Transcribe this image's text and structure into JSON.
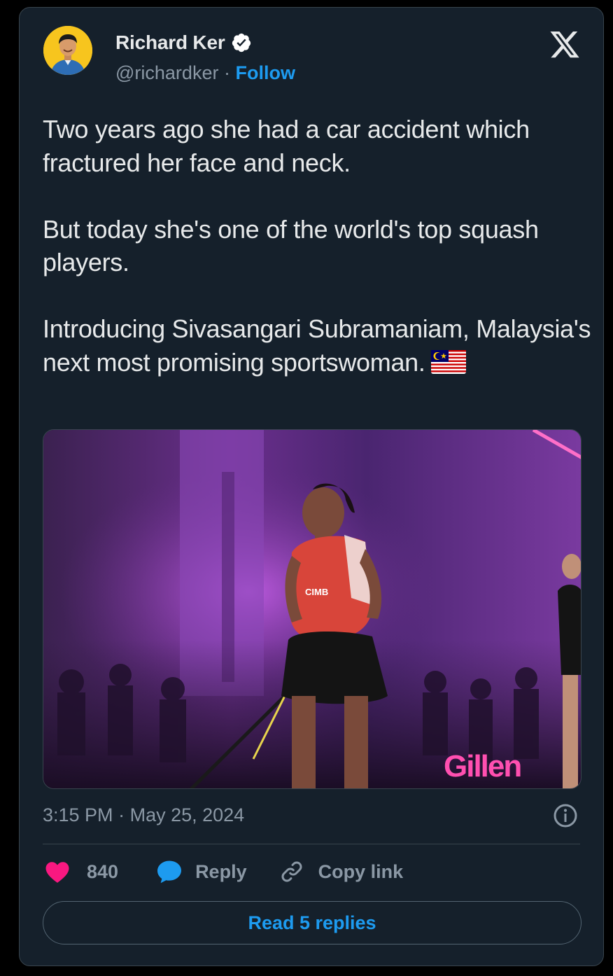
{
  "author": {
    "name": "Richard Ker",
    "handle": "@richardker",
    "separator": "·",
    "follow_label": "Follow"
  },
  "tweet": {
    "paragraphs": [
      "Two years ago she had a car accident which fractured her face and neck.",
      "But today she's one of the world's top squash players.",
      "Introducing Sivasangari Subramaniam, Malaysia's next most promising sportswoman."
    ],
    "emoji": "malaysia-flag"
  },
  "media": {
    "jersey_text": "CIMB",
    "banner_text": "Gillen"
  },
  "meta": {
    "time": "3:15 PM",
    "separator": "·",
    "date": "May 25, 2024"
  },
  "actions": {
    "like_count": "840",
    "reply_label": "Reply",
    "copy_link_label": "Copy link"
  },
  "read_replies_label": "Read 5 replies",
  "colors": {
    "background": "#15202b",
    "accent": "#1d9bf0",
    "like": "#f91880",
    "muted": "#8b98a5"
  }
}
